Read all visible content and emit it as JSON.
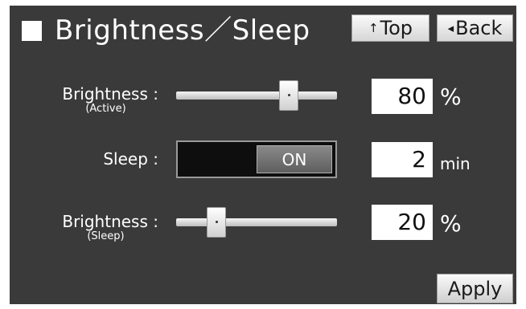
{
  "header": {
    "title": "Brightness／Sleep",
    "top_button": {
      "arrow": "↑",
      "label": "Top",
      "icon": "up-arrow-icon"
    },
    "back_button": {
      "arrow": "◂",
      "label": "Back",
      "icon": "left-triangle-icon"
    }
  },
  "brightness_active": {
    "label": "Brightness :",
    "sublabel": "(Active)",
    "value": "80",
    "unit": "%",
    "slider_level_percent": 80
  },
  "sleep": {
    "label": "Sleep :",
    "toggle_state": "ON",
    "value": "2",
    "unit": "min"
  },
  "brightness_sleep": {
    "label": "Brightness :",
    "sublabel": "(Sleep)",
    "value": "20",
    "unit": "%",
    "slider_level_percent": 20
  },
  "footer": {
    "apply_label": "Apply"
  },
  "colors": {
    "panel_background": "#3a3a3a",
    "text": "#ffffff",
    "toggle_track": "#0e0e0e"
  }
}
